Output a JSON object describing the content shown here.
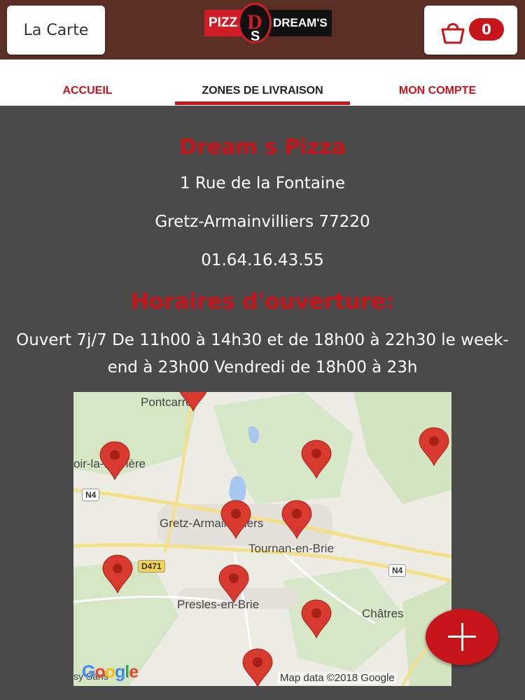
{
  "header": {
    "menu_button_label": "La Carte",
    "logo": {
      "left_text": "PIZZA",
      "right_text": "DREAM'S",
      "monogram": "D",
      "monogram_small": "S"
    },
    "cart_count": "0"
  },
  "nav": {
    "items": [
      {
        "label": "ACCUEIL"
      },
      {
        "label": "ZONES DE LIVRAISON"
      },
      {
        "label": "MON COMPTE"
      }
    ],
    "active_index": 1
  },
  "restaurant": {
    "name": "Dream s Pizza",
    "address_line1": "1 Rue de la Fontaine",
    "address_line2": "Gretz-Armainvilliers 77220",
    "phone": "01.64.16.43.55"
  },
  "hours": {
    "title": "Horaires d'ouverture:",
    "text": "Ouvert 7j/7 De 11h00 à 14h30 et de 18h00 à 22h30 le week-end à 23h00 Vendredi de 18h00 à 23h"
  },
  "map": {
    "places": [
      {
        "name": "Pontcarré"
      },
      {
        "name": "oir-la-Ferrière"
      },
      {
        "name": "Gretz-Armainvilliers"
      },
      {
        "name": "Tournan-en-Brie"
      },
      {
        "name": "Presles-en-Brie"
      },
      {
        "name": "Châtres"
      },
      {
        "name": "sy Sans"
      }
    ],
    "roads": [
      "N4",
      "D471",
      "N4"
    ],
    "logo_text": "Google",
    "attribution": "Map data ©2018 Google",
    "pin_count": 10
  },
  "colors": {
    "brand_red": "#c8141b",
    "header_brown": "#5b2f24",
    "page_bg": "#4a4a4a"
  },
  "fab": {
    "icon": "plus-icon"
  }
}
